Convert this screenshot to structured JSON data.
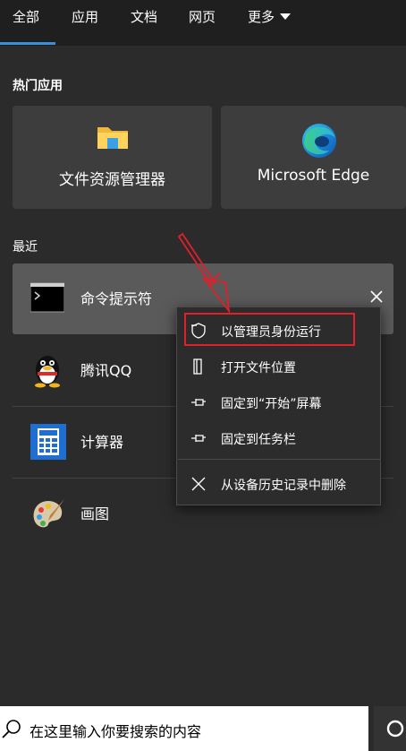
{
  "tabs": {
    "all": "全部",
    "apps": "应用",
    "docs": "文档",
    "web": "网页",
    "more": "更多"
  },
  "sections": {
    "hot_apps": "热门应用",
    "recent": "最近"
  },
  "tiles": [
    {
      "label": "文件资源管理器",
      "icon": "folder-icon"
    },
    {
      "label": "Microsoft Edge",
      "icon": "edge-icon"
    }
  ],
  "recent": [
    {
      "label": "命令提示符",
      "icon": "cmd-icon"
    },
    {
      "label": "腾讯QQ",
      "icon": "qq-icon"
    },
    {
      "label": "计算器",
      "icon": "calculator-icon"
    },
    {
      "label": "画图",
      "icon": "paint-icon"
    }
  ],
  "context_menu": [
    {
      "label": "以管理员身份运行",
      "icon": "shield-icon"
    },
    {
      "label": "打开文件位置",
      "icon": "file-location-icon"
    },
    {
      "label": "固定到“开始”屏幕",
      "icon": "pin-icon"
    },
    {
      "label": "固定到任务栏",
      "icon": "pin-icon"
    },
    {
      "label": "从设备历史记录中删除",
      "icon": "close-icon"
    }
  ],
  "search": {
    "placeholder": "在这里输入你要搜索的内容"
  },
  "colors": {
    "background": "#2b2b2b",
    "accent": "#3a8fd9",
    "annotation": "#e0202a"
  }
}
